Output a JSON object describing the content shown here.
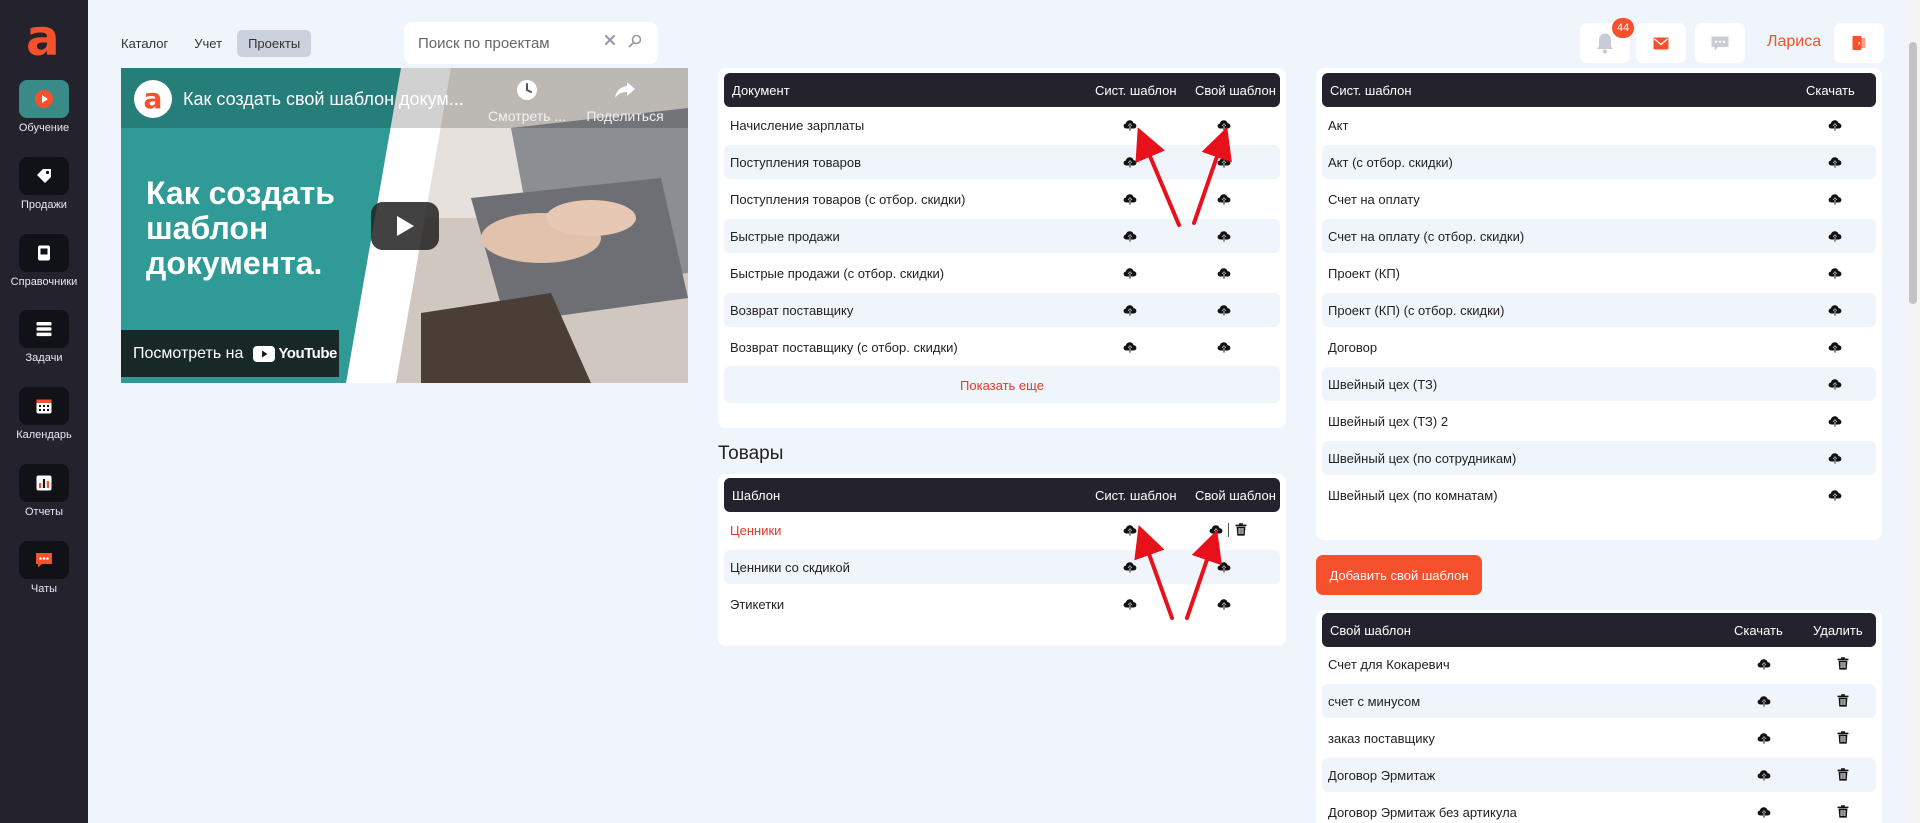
{
  "sidebar": {
    "logo_letter": "a",
    "items": [
      {
        "label": "Обучение",
        "icon": "play-icon"
      },
      {
        "label": "Продажи",
        "icon": "tag-icon"
      },
      {
        "label": "Справочники",
        "icon": "book-icon"
      },
      {
        "label": "Задачи",
        "icon": "tasks-icon"
      },
      {
        "label": "Календарь",
        "icon": "calendar-icon"
      },
      {
        "label": "Отчеты",
        "icon": "chart-icon"
      },
      {
        "label": "Чаты",
        "icon": "chat-icon"
      }
    ]
  },
  "topbar": {
    "tabs": [
      {
        "label": "Каталог",
        "active": false
      },
      {
        "label": "Учет",
        "active": false
      },
      {
        "label": "Проекты",
        "active": true
      }
    ],
    "search_placeholder": "Поиск по проектам",
    "notifications_count": "44",
    "user_name": "Лариса"
  },
  "video": {
    "title": "Как создать свой шаблон докум...",
    "watch_later": "Смотреть ...",
    "share": "Поделиться",
    "headline": "Как создать шаблон документа.",
    "watch_on": "Посмотреть на",
    "youtube": "YouTube"
  },
  "documents": {
    "headers": {
      "name": "Документ",
      "sys": "Сист. шаблон",
      "own": "Свой шаблон"
    },
    "rows": [
      "Начисление зарплаты",
      "Поступления товаров",
      "Поступления товаров (с отбор. скидки)",
      "Быстрые продажи",
      "Быстрые продажи (с отбор. скидки)",
      "Возврат поставщику",
      "Возврат поставщику (с отбор. скидки)"
    ],
    "show_more": "Показать еще"
  },
  "goods": {
    "title": "Товары",
    "headers": {
      "name": "Шаблон",
      "sys": "Сист. шаблон",
      "own": "Свой шаблон"
    },
    "rows": [
      "Ценники",
      "Ценники со скдикой",
      "Этикетки"
    ]
  },
  "sys_templates": {
    "headers": {
      "name": "Сист. шаблон",
      "download": "Скачать"
    },
    "rows": [
      "Акт",
      "Акт (с отбор. скидки)",
      "Счет на оплату",
      "Счет на оплату (с отбор. скидки)",
      "Проект (КП)",
      "Проект (КП) (с отбор. скидки)",
      "Договор",
      "Швейный цех (ТЗ)",
      "Швейный цех (ТЗ) 2",
      "Швейный цех (по сотрудникам)",
      "Швейный цех (по комнатам)"
    ]
  },
  "add_template_label": "Добавить свой шаблон",
  "own_templates": {
    "headers": {
      "name": "Свой шаблон",
      "download": "Скачать",
      "delete": "Удалить"
    },
    "rows": [
      "Счет для Кокаревич",
      "счет с минусом",
      "заказ поставщику",
      "Договор Эрмитаж",
      "Договор Эрмитаж без артикула"
    ]
  },
  "colors": {
    "accent": "#f4512c",
    "sidebar": "#24232d",
    "teal": "#309b97",
    "arrow": "#e8101a"
  }
}
